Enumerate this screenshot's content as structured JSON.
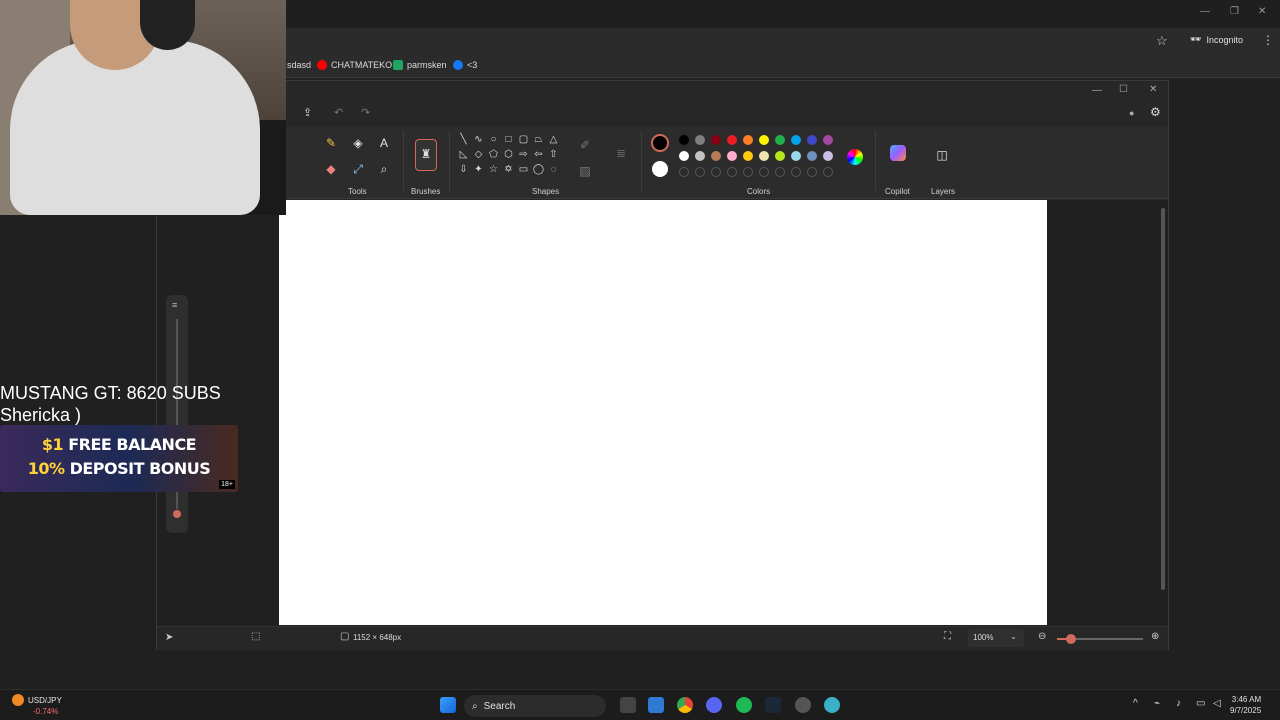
{
  "browser": {
    "bookmarks": [
      {
        "label": "sdasd"
      },
      {
        "label": "CHATMATEKO",
        "icon": "youtube-icon",
        "color": "#ff0000"
      },
      {
        "label": "parmsken",
        "icon": "sheets-icon",
        "color": "#1fa463"
      },
      {
        "label": "<3",
        "icon": "facebook-icon",
        "color": "#1877f2"
      }
    ],
    "incognito_label": "Incognito"
  },
  "paint": {
    "groups": {
      "tools": "Tools",
      "brushes": "Brushes",
      "shapes": "Shapes",
      "colors": "Colors",
      "copilot": "Copilot",
      "layers": "Layers"
    },
    "colors": {
      "row1": [
        "#000000",
        "#7f7f7f",
        "#880015",
        "#ed1c24",
        "#ff7f27",
        "#fff200",
        "#22b14c",
        "#00a2e8",
        "#3f48cc",
        "#a349a4"
      ],
      "row2": [
        "#ffffff",
        "#c3c3c3",
        "#b97a57",
        "#ffaec9",
        "#ffc90e",
        "#efe4b0",
        "#b5e61d",
        "#99d9ea",
        "#7092be",
        "#c8bfe7"
      ],
      "primary": "#000000",
      "secondary": "#ffffff"
    },
    "status": {
      "canvas_size": "1152 × 648px",
      "zoom": "100%"
    }
  },
  "overlay": {
    "line1": "MUSTANG GT: 8620 SUBS",
    "line2": "Shericka )",
    "promo": {
      "line1_accent": "$1",
      "line1": " FREE BALANCE",
      "line2_accent": "10%",
      "line2": " DEPOSIT BONUS",
      "age": "18+"
    }
  },
  "taskbar": {
    "ticker_symbol": "USD/JPY",
    "ticker_change": "-0.74%",
    "search_placeholder": "Search",
    "time": "3:46 AM",
    "date": "9/7/2025"
  }
}
